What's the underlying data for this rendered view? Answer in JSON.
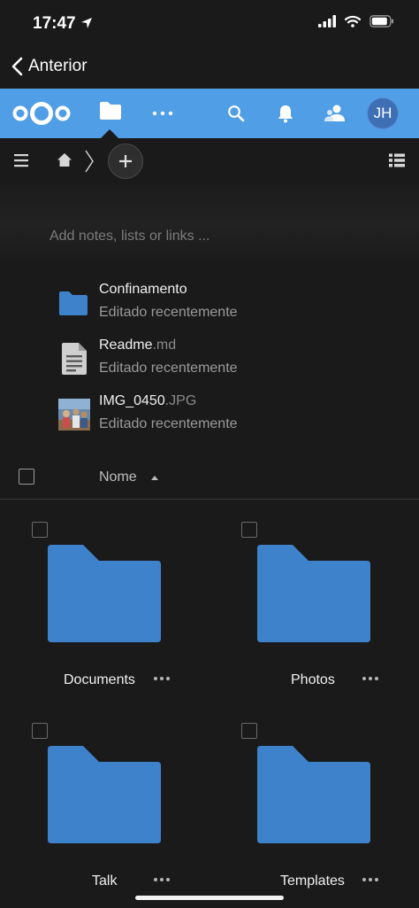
{
  "status": {
    "time": "17:47"
  },
  "nav": {
    "back_label": "Anterior"
  },
  "header": {
    "avatar_initials": "JH",
    "accent": "#4f9ee6"
  },
  "breadcrumb": {
    "home": "home-icon"
  },
  "notes": {
    "placeholder": "Add notes, lists or links ..."
  },
  "recent": [
    {
      "name": "Confinamento",
      "ext": "",
      "subtitle": "Editado recentemente",
      "icon": "folder-icon"
    },
    {
      "name": "Readme",
      "ext": ".md",
      "subtitle": "Editado recentemente",
      "icon": "document-icon"
    },
    {
      "name": "IMG_0450",
      "ext": ".JPG",
      "subtitle": "Editado recentemente",
      "icon": "photo-thumbnail"
    }
  ],
  "list": {
    "sort_label": "Nome",
    "sort_direction": "ascending"
  },
  "files": [
    {
      "name": "Documents"
    },
    {
      "name": "Photos"
    },
    {
      "name": "Talk"
    },
    {
      "name": "Templates"
    }
  ],
  "colors": {
    "folder": "#3e82cc",
    "folder_tab": "#3a7bc2",
    "background": "#1a1a1a"
  }
}
